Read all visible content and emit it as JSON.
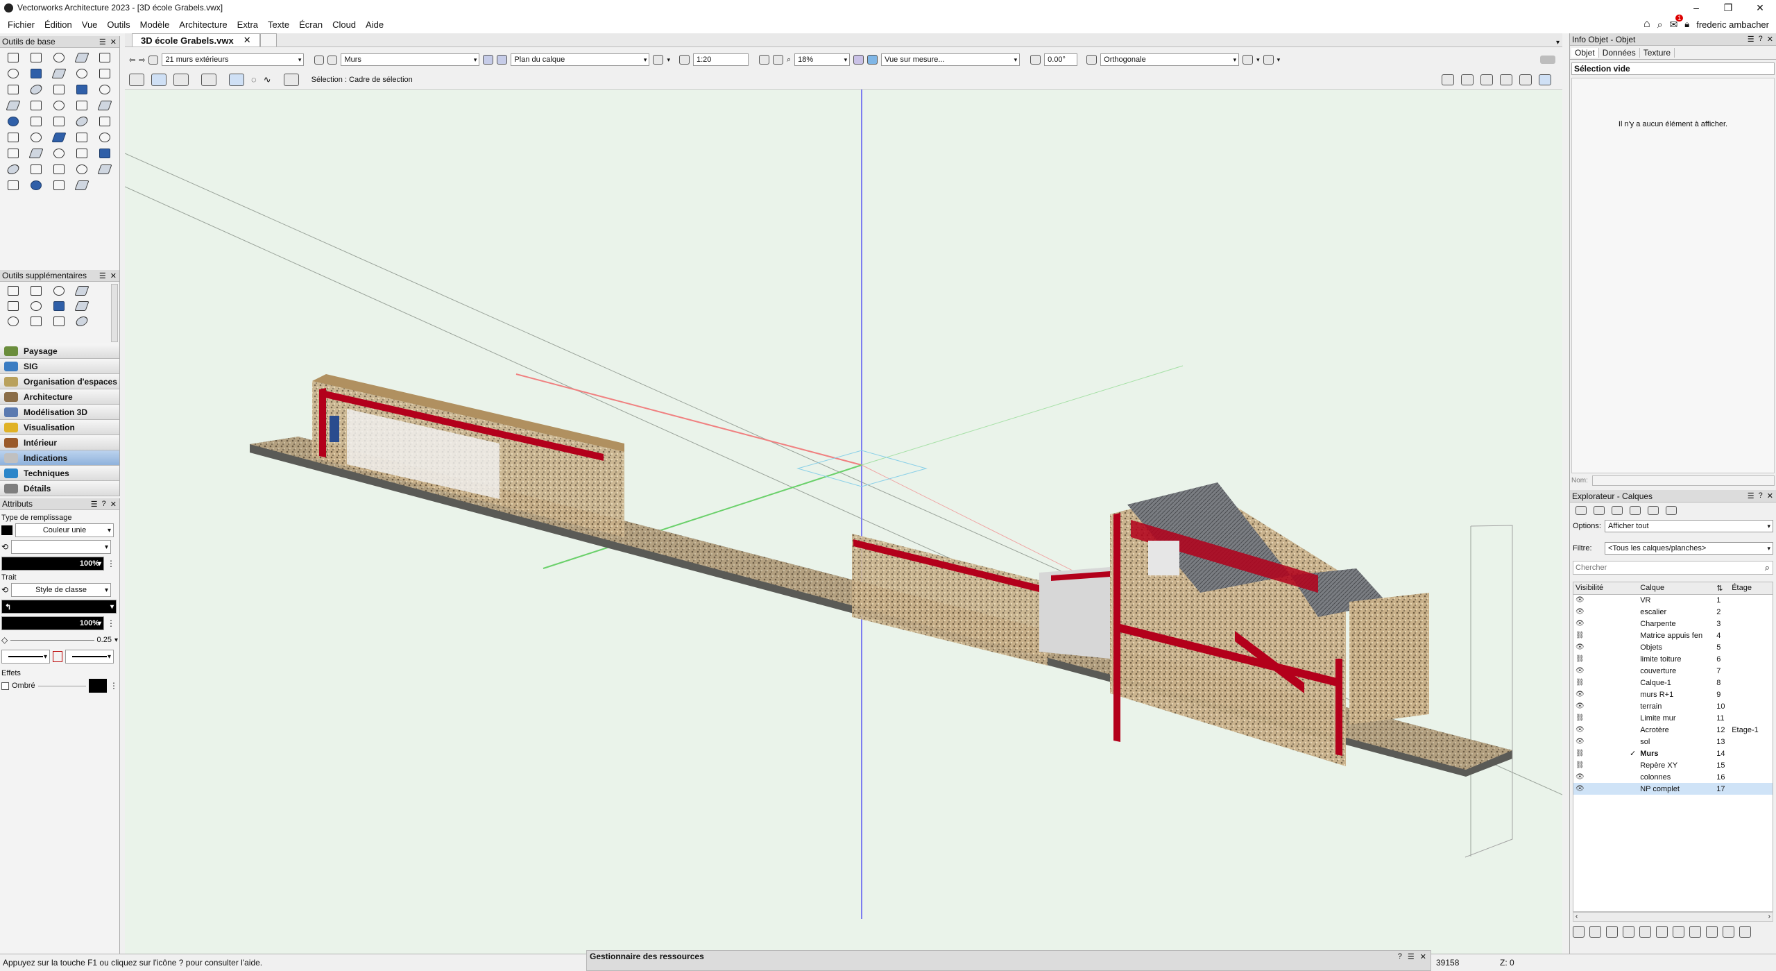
{
  "window": {
    "title": "Vectorworks Architecture 2023 - [3D école Grabels.vwx]"
  },
  "menu": {
    "items": [
      "Fichier",
      "Édition",
      "Vue",
      "Outils",
      "Modèle",
      "Architecture",
      "Extra",
      "Texte",
      "Écran",
      "Cloud",
      "Aide"
    ],
    "user": "frederic ambacher",
    "badge": "1"
  },
  "left": {
    "basic_tools_title": "Outils de base",
    "extra_tools_title": "Outils supplémentaires",
    "palettes": [
      "Paysage",
      "SIG",
      "Organisation d'espaces",
      "Architecture",
      "Modélisation 3D",
      "Visualisation",
      "Intérieur",
      "Indications",
      "Techniques",
      "Détails"
    ],
    "selected_palette": "Indications",
    "attributes": {
      "title": "Attributs",
      "fill_type_label": "Type de remplissage",
      "fill_value": "Couleur unie",
      "fill_opacity": "100%",
      "stroke_label": "Trait",
      "stroke_value": "Style de classe",
      "stroke_opacity": "100%",
      "line_weight": "0.25",
      "effects_label": "Effets",
      "shadow_label": "Ombré"
    }
  },
  "document": {
    "tab": "3D école Grabels.vwx"
  },
  "toolbar": {
    "selection": "21 murs extérieurs",
    "class": "Murs",
    "layer_plane": "Plan du calque",
    "scale": "1:20",
    "zoom": "18%",
    "view": "Vue sur mesure...",
    "rotation": "0.00°",
    "projection": "Orthogonale",
    "mode_text": "Sélection : Cadre de sélection"
  },
  "info": {
    "title": "Info Objet - Objet",
    "tabs": [
      "Objet",
      "Données",
      "Texture"
    ],
    "empty_title": "Sélection vide",
    "empty_msg": "Il n'y a aucun élément à afficher.",
    "name_label": "Nom:"
  },
  "explorer": {
    "title": "Explorateur - Calques",
    "options_label": "Options:",
    "options_value": "Afficher tout",
    "filter_label": "Filtre:",
    "filter_value": "<Tous les calques/planches>",
    "search_placeholder": "Chercher",
    "headers": {
      "visibility": "Visibilité",
      "layer": "Calque",
      "story": "Étage"
    },
    "layers": [
      {
        "vis": "eye",
        "active": "",
        "name": "VR",
        "num": "1",
        "story": ""
      },
      {
        "vis": "eye",
        "active": "",
        "name": "escalier",
        "num": "2",
        "story": ""
      },
      {
        "vis": "eye",
        "active": "",
        "name": "Charpente",
        "num": "3",
        "story": ""
      },
      {
        "vis": "hidden",
        "active": "",
        "name": "Matrice appuis fen",
        "num": "4",
        "story": ""
      },
      {
        "vis": "eye",
        "active": "",
        "name": "Objets",
        "num": "5",
        "story": ""
      },
      {
        "vis": "hidden",
        "active": "",
        "name": "limite toiture",
        "num": "6",
        "story": ""
      },
      {
        "vis": "eye",
        "active": "",
        "name": "couverture",
        "num": "7",
        "story": ""
      },
      {
        "vis": "hidden",
        "active": "",
        "name": "Calque-1",
        "num": "8",
        "story": ""
      },
      {
        "vis": "eye",
        "active": "",
        "name": "murs R+1",
        "num": "9",
        "story": ""
      },
      {
        "vis": "eye",
        "active": "",
        "name": "terrain",
        "num": "10",
        "story": ""
      },
      {
        "vis": "hidden",
        "active": "",
        "name": "Limite mur",
        "num": "11",
        "story": ""
      },
      {
        "vis": "eye",
        "active": "",
        "name": "Acrotère",
        "num": "12",
        "story": "Etage-1"
      },
      {
        "vis": "eye",
        "active": "",
        "name": "sol",
        "num": "13",
        "story": ""
      },
      {
        "vis": "hidden",
        "active": "✓",
        "name": "Murs",
        "num": "14",
        "story": ""
      },
      {
        "vis": "hidden",
        "active": "",
        "name": "Repère XY",
        "num": "15",
        "story": ""
      },
      {
        "vis": "eye",
        "active": "",
        "name": "colonnes",
        "num": "16",
        "story": ""
      },
      {
        "vis": "eye",
        "active": "",
        "name": "NP complet",
        "num": "17",
        "story": ""
      }
    ],
    "selected_layer": "NP complet"
  },
  "status": {
    "help": "Appuyez sur la touche F1 ou cliquez sur l'icône ? pour consulter l'aide.",
    "resource_manager": "Gestionnaire des ressources",
    "coord_x": "39158",
    "coord_z": "Z: 0"
  },
  "colors": {
    "accent": "#8fb2dc",
    "section_red": "#b3001b",
    "selection_blue": "#cfe3f7"
  }
}
